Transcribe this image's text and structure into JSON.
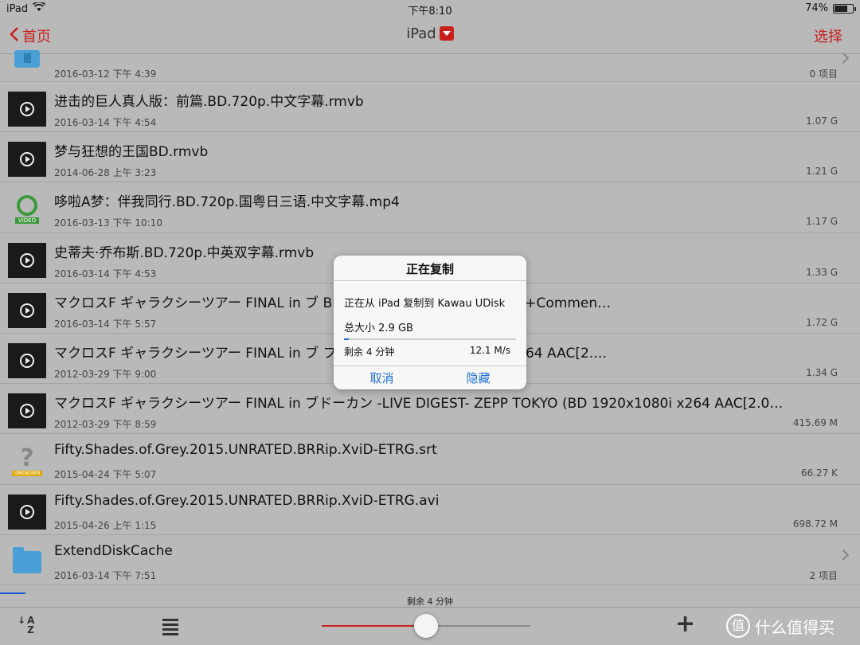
{
  "status_bar": {
    "device": "iPad",
    "time": "下午8:10",
    "battery": "74%",
    "battery_level": 0.74
  },
  "navbar": {
    "back_label": "首页",
    "title": "iPad",
    "select_label": "选择"
  },
  "first_row": {
    "date": "2016-03-12 下午 4:39",
    "size": "0 项目"
  },
  "files": [
    {
      "icon": "video",
      "name": "进击的巨人真人版：前篇.BD.720p.中文字幕.rmvb",
      "date": "2016-03-14 下午 4:54",
      "size": "1.07 G"
    },
    {
      "icon": "video",
      "name": "梦与狂想的王国BD.rmvb",
      "date": "2014-06-28 上午 3:23",
      "size": "1.21 G"
    },
    {
      "icon": "mp4",
      "name": "哆啦A梦：伴我同行.BD.720p.国粤日三语.中文字幕.mp4",
      "date": "2016-03-13 下午 10:10",
      "size": "1.17 G",
      "tag": "VIDEO"
    },
    {
      "icon": "video",
      "name": "史蒂夫·乔布斯.BD.720p.中英双字幕.rmvb",
      "date": "2016-03-14 下午 4:53",
      "size": "1.33 G"
    },
    {
      "icon": "video",
      "name": "マクロスF ギャラクシーツアー FINAL in ブ                              BD 1920x1080i x264 AAC[2.0+Commen…",
      "date": "2016-03-14 下午 5:57",
      "size": "1.72 G"
    },
    {
      "icon": "video",
      "name": "マクロスF ギャラクシーツアー FINAL in ブ                              フィコ横浜 (BD 1920x1080i x264 AAC[2.…",
      "date": "2012-03-29 下午 9:00",
      "size": "1.34 G"
    },
    {
      "icon": "video",
      "name": "マクロスF ギャラクシーツアー FINAL in ブドーカン -LIVE DIGEST- ZEPP TOKYO (BD 1920x1080i x264 AAC[2.0…",
      "date": "2012-03-29 下午 8:59",
      "size": "415.69 M"
    },
    {
      "icon": "unknown",
      "name": "Fifty.Shades.of.Grey.2015.UNRATED.BRRip.XviD-ETRG.srt",
      "date": "2015-04-24 下午 5:07",
      "size": "66.27 K",
      "tag": "UNKNOWN"
    },
    {
      "icon": "video",
      "name": "Fifty.Shades.of.Grey.2015.UNRATED.BRRip.XviD-ETRG.avi",
      "date": "2015-04-26 上午 1:15",
      "size": "698.72 M"
    },
    {
      "icon": "folder",
      "name": "ExtendDiskCache",
      "date": "2016-03-14 下午 7:51",
      "size": "2 项目",
      "chevron": true
    }
  ],
  "bottom_progress": {
    "text": "剩余 4 分钟",
    "fraction": 0.03
  },
  "toolbar": {
    "sort_top": "A",
    "sort_bottom": "Z",
    "plus": "+",
    "slider_value": 0.5,
    "watermark": "什么值得买",
    "watermark_logo": "值"
  },
  "dialog": {
    "title": "正在复制",
    "message": "正在从 iPad 复制到 Kawau UDisk",
    "total": "总大小 2.9 GB",
    "progress": 0.03,
    "remaining": "剩余 4 分钟",
    "speed": "12.1 M/s",
    "cancel": "取消",
    "hide": "隐藏"
  },
  "colors": {
    "accent": "#c8201f",
    "link": "#1e6fd6",
    "background": "#b9b9b9"
  }
}
